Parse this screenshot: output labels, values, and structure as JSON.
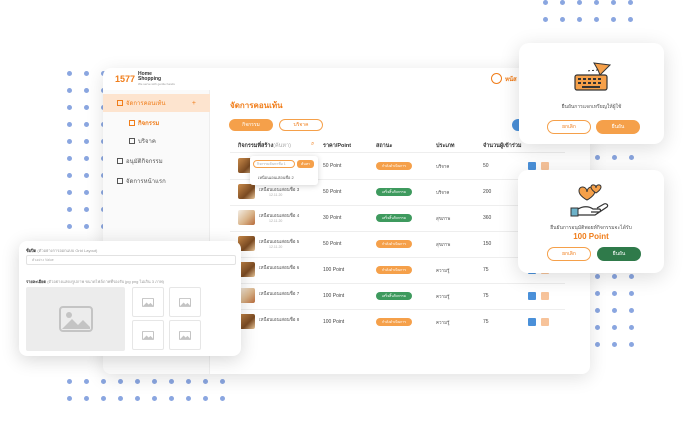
{
  "app": {
    "logo_number": "1577",
    "logo_brand_line1": "Home",
    "logo_brand_line2": "Shopping",
    "logo_tagline": "We serve with gentle hands",
    "user_name": "หน้ส"
  },
  "sidebar": {
    "items": [
      {
        "label": "จัดการคอนเท้น",
        "active": true,
        "expand": "+"
      },
      {
        "label": "กิจกรรม",
        "active": true
      },
      {
        "label": "บริจาค",
        "active": false
      },
      {
        "label": "อนุมัติกิจกรรม",
        "active": false
      },
      {
        "label": "จัดการหน้าแรก",
        "active": false
      }
    ]
  },
  "main": {
    "title": "จัดการคอนเท้น",
    "tabs": [
      "กิจกรรม",
      "บริจาค"
    ],
    "columns": [
      "กิจกรรมที่สร้าง",
      "ราคา/Point",
      "สถานะ",
      "ประเภท",
      "จำนวนผู้เข้าร่วม"
    ],
    "column_hint": "(ค้นหา)",
    "search_dropdown": {
      "placeholder": "กิจกรรมค้นหาชื่อ 1",
      "button": "ค้นหา",
      "result": "เหนือนเอนเสอนชื่อ 2"
    },
    "rows": [
      {
        "name": "",
        "date": "",
        "point": "50 Point",
        "status": "กำลังดำเนินการ",
        "status_color": "orange",
        "type": "บริจาค",
        "count": "50"
      },
      {
        "name": "เหนือนเอนเสอนชื่อ 3",
        "date": "12.11.20",
        "point": "50 Point",
        "status": "เสร็จสิ้นกิจกรรม",
        "status_color": "green",
        "type": "บริจาค",
        "count": "200"
      },
      {
        "name": "เหนือนเอนเสอนชื่อ 4",
        "date": "12.11.20",
        "point": "30 Point",
        "status": "เสร็จสิ้นกิจกรรม",
        "status_color": "green",
        "type": "สุขภาพ",
        "count": "360"
      },
      {
        "name": "เหนือนเอนเสอนชื่อ 5",
        "date": "12.11.20",
        "point": "50 Point",
        "status": "กำลังดำเนินการ",
        "status_color": "orange",
        "type": "สุขภาพ",
        "count": "150"
      },
      {
        "name": "เหนือนเอนเสอนชื่อ 6",
        "date": "",
        "point": "100 Point",
        "status": "กำลังดำเนินการ",
        "status_color": "orange",
        "type": "ความรู้",
        "count": "75"
      },
      {
        "name": "เหนือนเอนเสอนชื่อ 7",
        "date": "",
        "point": "100 Point",
        "status": "เสร็จสิ้นกิจกรรม",
        "status_color": "green",
        "type": "ความรู้",
        "count": "75"
      },
      {
        "name": "เหนือนเอนเสอนชื่อ 8",
        "date": "",
        "point": "100 Point",
        "status": "กำลังดำเนินการ",
        "status_color": "orange",
        "type": "ความรู้",
        "count": "75"
      }
    ]
  },
  "form_card": {
    "title_label": "ชื่อปีด",
    "title_hint": "(ตัวอย่างการออกแบบ Grid Layout)",
    "title_value": "ตัวอย่าง Value",
    "detail_label": "รายละเอียด",
    "detail_hint": "(ตัวอย่างแสดงรูปภาพ ขนาดไฟล์ภาพที่รองรับ jpg png ไม่เกิน 3 ภาพ)"
  },
  "popup_confirm_keyboard": {
    "message": "ยืนยันการแจกเหรียญให้ผู้ใช้",
    "cancel": "ยกเลิก",
    "confirm": "ยืนยัน"
  },
  "popup_confirm_point": {
    "message": "ยืนยันการอนุมัติพอยท์กิจกรรมจะได้รับ",
    "point": "100 Point",
    "cancel": "ยกเลิก",
    "confirm": "ยืนยัน"
  },
  "colors": {
    "accent": "#f07d1a",
    "accent_light": "#f5a04a",
    "green": "#3e9a5e",
    "blue": "#4a90d9",
    "dots": "#8aa6e0"
  }
}
